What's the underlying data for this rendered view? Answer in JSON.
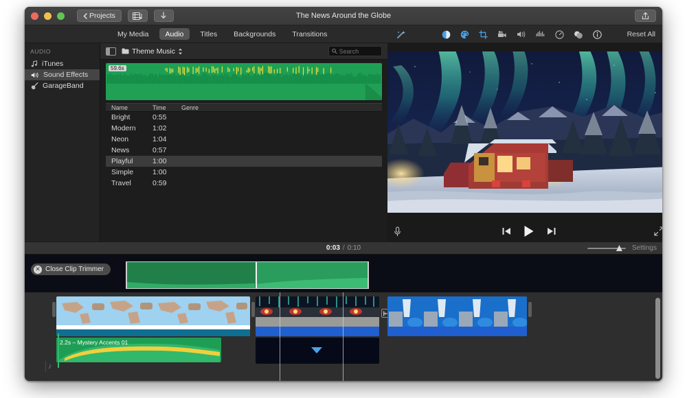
{
  "window": {
    "title": "The News Around the Globe",
    "back_button": "Projects",
    "traffic_lights": [
      "close-red",
      "minimize-yellow",
      "zoom-green"
    ],
    "media_button_icon": "media-browser-icon",
    "import_button_icon": "import-download-icon",
    "share_button_icon": "share-export-icon"
  },
  "tabs": [
    {
      "label": "My Media",
      "active": false
    },
    {
      "label": "Audio",
      "active": true
    },
    {
      "label": "Titles",
      "active": false
    },
    {
      "label": "Backgrounds",
      "active": false
    },
    {
      "label": "Transitions",
      "active": false
    }
  ],
  "inspector": {
    "magic_icon": "magic-wand-enhance-icon",
    "reset_label": "Reset All",
    "tools": [
      {
        "name": "color-balance-icon",
        "active": true
      },
      {
        "name": "color-correction-palette-icon",
        "active": true
      },
      {
        "name": "crop-icon",
        "active": true
      },
      {
        "name": "stabilization-camera-icon",
        "active": false
      },
      {
        "name": "volume-speaker-icon",
        "active": false
      },
      {
        "name": "noise-reduction-equalizer-icon",
        "active": false
      },
      {
        "name": "speed-gauge-icon",
        "active": false
      },
      {
        "name": "clip-filter-icon",
        "active": false
      },
      {
        "name": "info-icon",
        "active": false
      }
    ]
  },
  "sidebar": {
    "header": "AUDIO",
    "items": [
      {
        "label": "iTunes",
        "icon": "music-note-icon",
        "selected": false
      },
      {
        "label": "Sound Effects",
        "icon": "speaker-waves-icon",
        "selected": true
      },
      {
        "label": "GarageBand",
        "icon": "guitar-icon",
        "selected": false
      }
    ]
  },
  "browser": {
    "panel_toggle_icon": "sidebar-toggle-icon",
    "folder_icon": "folder-icon",
    "category": "Theme Music",
    "category_chevron": "sort-updown-chevron-icon",
    "search_placeholder": "Search",
    "search_value": "",
    "search_icon": "search-magnifier-icon",
    "waveform_duration": "59.6s",
    "columns": [
      "Name",
      "Time",
      "Genre"
    ],
    "rows": [
      {
        "name": "Bright",
        "time": "0:55",
        "genre": "",
        "selected": false
      },
      {
        "name": "Modern",
        "time": "1:02",
        "genre": "",
        "selected": false
      },
      {
        "name": "Neon",
        "time": "1:04",
        "genre": "",
        "selected": false
      },
      {
        "name": "News",
        "time": "0:57",
        "genre": "",
        "selected": false
      },
      {
        "name": "Playful",
        "time": "1:00",
        "genre": "",
        "selected": true
      },
      {
        "name": "Simple",
        "time": "1:00",
        "genre": "",
        "selected": false
      },
      {
        "name": "Travel",
        "time": "0:59",
        "genre": "",
        "selected": false
      }
    ]
  },
  "viewer": {
    "frame_description": "red cabin in snow under aurora borealis",
    "voiceover_icon": "microphone-icon",
    "previous_icon": "skip-to-start-icon",
    "play_icon": "play-icon",
    "next_icon": "skip-to-end-icon",
    "fullscreen_icon": "expand-fullscreen-icon"
  },
  "timecode": {
    "current": "0:03",
    "separator": "/",
    "total": "0:10",
    "zoom_value": 75,
    "settings_label": "Settings"
  },
  "timeline": {
    "close_trimmer_label": "Close Clip Trimmer",
    "close_trimmer_icon": "close-x-circle-icon",
    "audio_clip_label": "2.2s – Mystery Accents 01",
    "connect_icon": "attach-connection-icon",
    "music_track_icon": "music-note-icon",
    "clips": [
      {
        "name": "world-map-clip"
      },
      {
        "name": "city-night-clip"
      },
      {
        "name": "waterfall-clip"
      }
    ]
  },
  "colors": {
    "accent_blue": "#4ea3e8",
    "waveform_green": "#1fa055",
    "audio_blue": "#1f5fd0",
    "selection_gray": "#3c3c3c"
  }
}
